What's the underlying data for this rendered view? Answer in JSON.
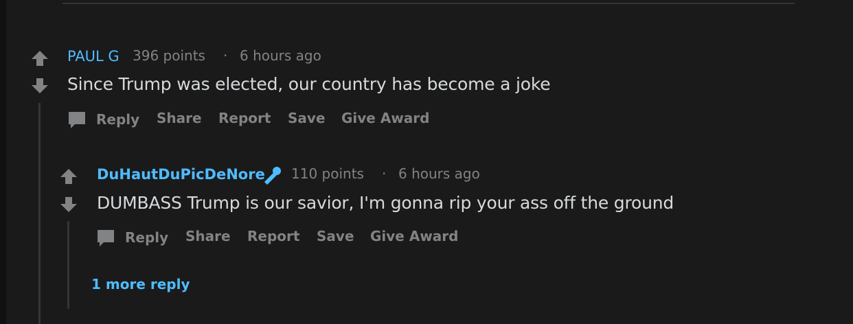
{
  "comment": {
    "author": "PAUL G",
    "points": "396 points",
    "separator": "·",
    "time": "6 hours ago",
    "body": "Since Trump was elected, our country has become a joke",
    "actions": {
      "reply": "Reply",
      "share": "Share",
      "report": "Report",
      "save": "Save",
      "award": "Give Award"
    }
  },
  "reply": {
    "author": "DuHautDuPicDeNore",
    "flair_icon": "microphone-icon",
    "points": "110 points",
    "separator": "·",
    "time": "6 hours ago",
    "body": "DUMBASS Trump is our savior, I'm gonna rip your ass off the ground",
    "actions": {
      "reply": "Reply",
      "share": "Share",
      "report": "Report",
      "save": "Save",
      "award": "Give Award"
    },
    "more_replies": "1 more reply"
  },
  "colors": {
    "background": "#1a1a1b",
    "text": "#d7dadc",
    "meta": "#818384",
    "link": "#4fbcff"
  }
}
